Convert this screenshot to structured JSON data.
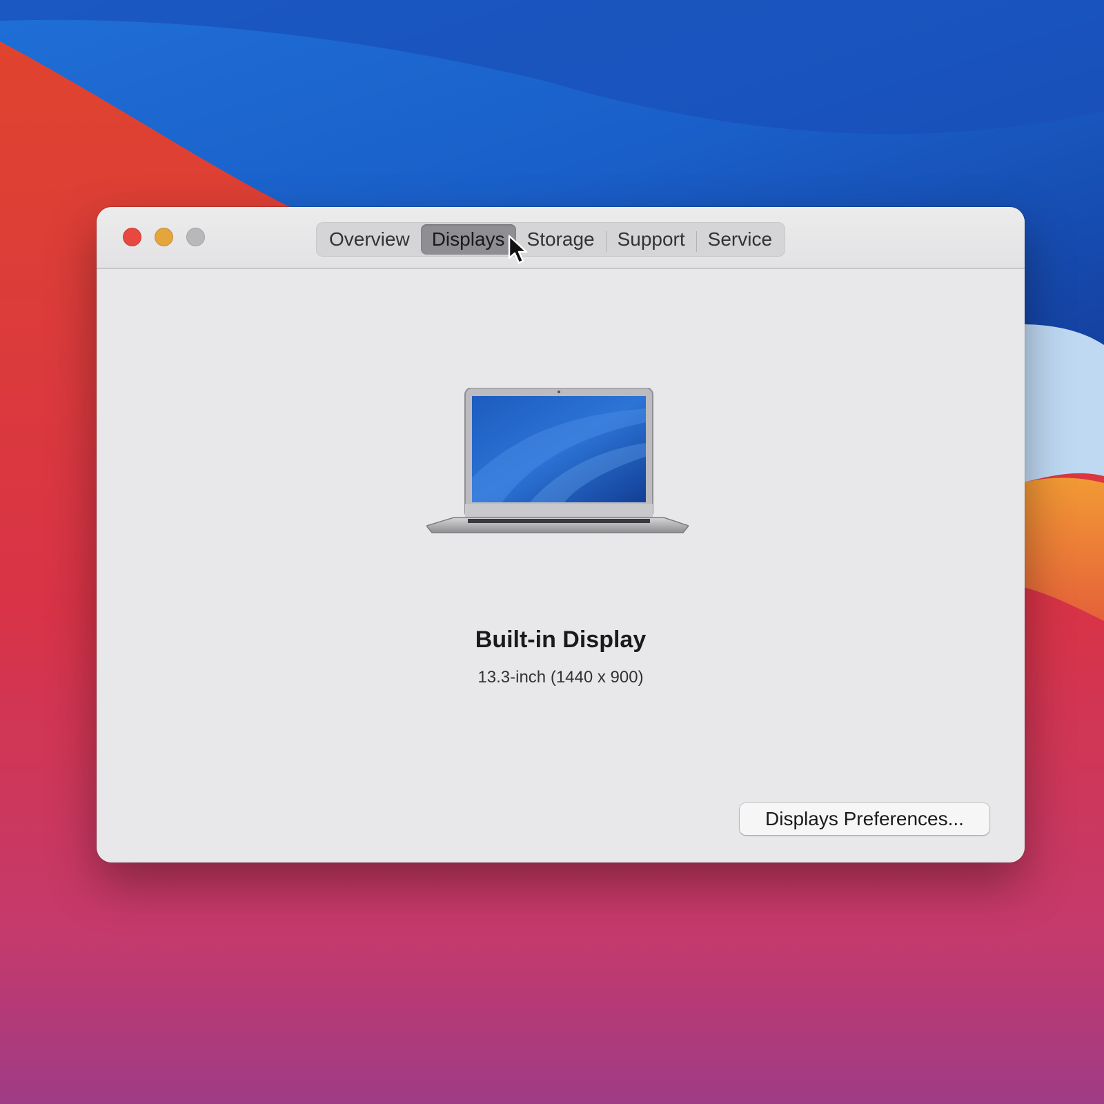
{
  "window": {
    "tabs": [
      {
        "label": "Overview",
        "active": false
      },
      {
        "label": "Displays",
        "active": true
      },
      {
        "label": "Storage",
        "active": false
      },
      {
        "label": "Support",
        "active": false
      },
      {
        "label": "Service",
        "active": false
      }
    ]
  },
  "display": {
    "title": "Built-in Display",
    "detail": "13.3-inch (1440 x 900)",
    "icon": "laptop-icon"
  },
  "buttons": {
    "preferences_label": "Displays Preferences..."
  },
  "colors": {
    "close": "#e8483f",
    "minimize": "#e4a53c",
    "zoom": "#b8b8bb",
    "active_tab": "#8e8e93"
  }
}
